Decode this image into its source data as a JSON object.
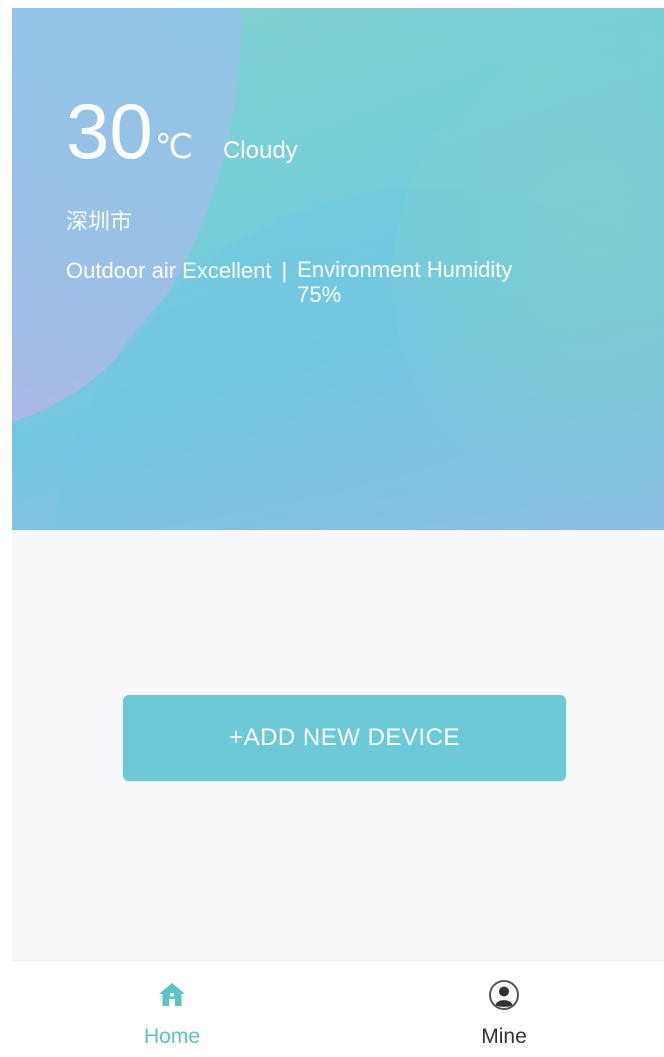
{
  "weather": {
    "temperature": "30",
    "unit": "℃",
    "condition": "Cloudy",
    "city": "深圳市",
    "air_quality": "Outdoor air Excellent",
    "separator": "|",
    "humidity_label": "Environment Humidity",
    "humidity_value": "75%"
  },
  "main": {
    "add_device_label": "+ADD NEW DEVICE"
  },
  "tabbar": {
    "tabs": [
      {
        "label": "Home",
        "icon": "home-icon",
        "active": true
      },
      {
        "label": "Mine",
        "icon": "user-icon",
        "active": false
      }
    ]
  },
  "colors": {
    "accent": "#6cc9d8",
    "active_tab": "#5cc3c3",
    "banner_start": "#84d2cc",
    "banner_end": "#a4b8df"
  }
}
